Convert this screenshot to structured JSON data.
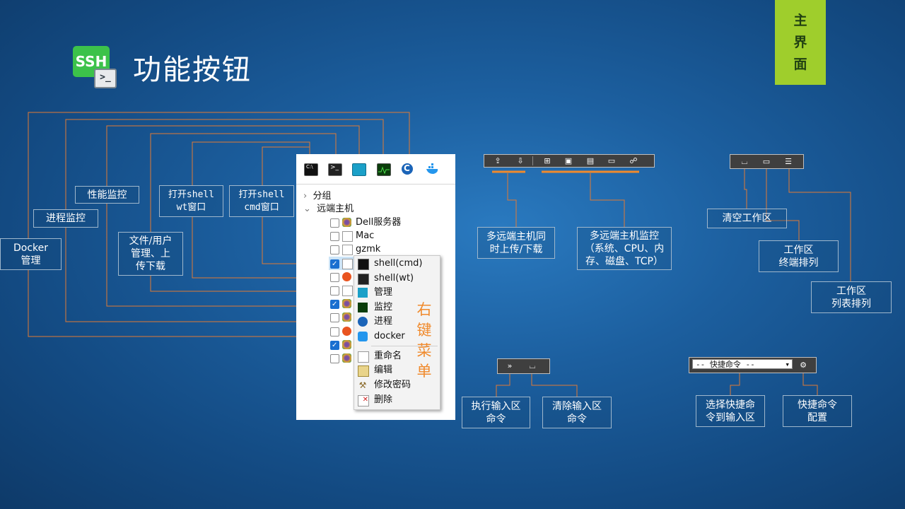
{
  "title": "功能按钮",
  "logo": {
    "text": "SSH",
    "icon": "terminal-icon"
  },
  "badge": {
    "line1": "主",
    "line2": "界",
    "line3": "面"
  },
  "labels": {
    "docker": "Docker\n管理",
    "process": "进程监控",
    "perf": "性能监控",
    "file": "文件/用户\n管理、上\n传下载",
    "shell_wt": "打开shell\nwt窗口",
    "shell_cmd": "打开shell\ncmd窗口",
    "multi_upload": "多远端主机同\n时上传/下载",
    "multi_monitor": "多远端主机监控\n（系统、CPU、内\n存、磁盘、TCP）",
    "clear_work": "清空工作区",
    "work_terminal": "工作区\n终端排列",
    "work_list": "工作区\n列表排列",
    "exec_input": "执行输入区\n命令",
    "clear_input": "清除输入区\n命令",
    "select_quick": "选择快捷命\n令到输入区",
    "quick_config": "快捷命令\n配置"
  },
  "tree": {
    "group": "分组",
    "remote": "远端主机",
    "hosts": [
      {
        "name": "Dell服务器",
        "checked": false,
        "icon": "gear-cluster-icon"
      },
      {
        "name": "Mac",
        "checked": false,
        "icon": "document-icon"
      },
      {
        "name": "gzmk",
        "checked": false,
        "icon": "document-icon"
      },
      {
        "name": "",
        "checked": true,
        "icon": "document-icon"
      },
      {
        "name": "",
        "checked": false,
        "icon": "ubuntu-icon"
      },
      {
        "name": "",
        "checked": false,
        "icon": "document-icon"
      },
      {
        "name": "",
        "checked": true,
        "icon": "gear-cluster-icon"
      },
      {
        "name": "",
        "checked": false,
        "icon": "gear-cluster-icon"
      },
      {
        "name": "",
        "checked": false,
        "icon": "ubuntu-icon"
      },
      {
        "name": "",
        "checked": true,
        "icon": "gear-cluster-icon"
      },
      {
        "name": "",
        "checked": false,
        "icon": "gear-cluster-icon"
      }
    ]
  },
  "context_menu": {
    "items": [
      "shell(cmd)",
      "shell(wt)",
      "管理",
      "监控",
      "进程",
      "docker"
    ],
    "items2": [
      "重命名",
      "编辑",
      "修改密码",
      "删除"
    ],
    "side_label": [
      "右",
      "键",
      "菜",
      "单"
    ]
  },
  "combo_text": "-- 快捷命令 --",
  "colors": {
    "accent_orange": "#f08a2c",
    "badge_green": "#9fce2c",
    "line": "#e07a35"
  }
}
